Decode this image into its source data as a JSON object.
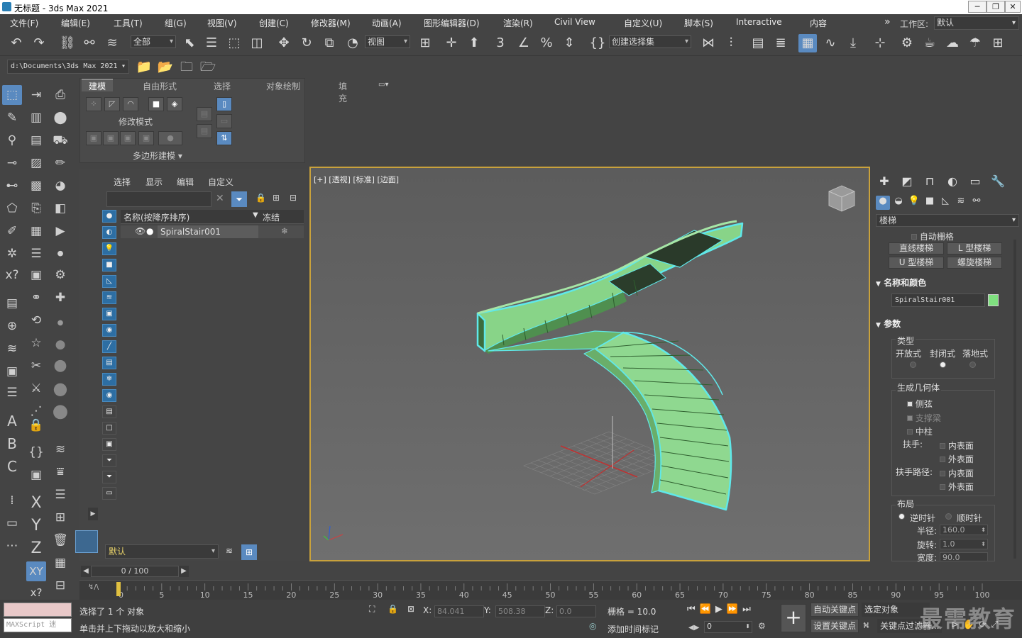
{
  "window": {
    "title": "无标题 - 3ds Max 2021"
  },
  "menu": [
    "文件(F)",
    "编辑(E)",
    "工具(T)",
    "组(G)",
    "视图(V)",
    "创建(C)",
    "修改器(M)",
    "动画(A)",
    "图形编辑器(D)",
    "渲染(R)",
    "Civil View",
    "自定义(U)",
    "脚本(S)",
    "Interactive",
    "内容"
  ],
  "workspace": {
    "label": "工作区:",
    "value": "默认"
  },
  "toolbar": {
    "filter": "全部",
    "refcoord": "视图",
    "selset": "创建选择集"
  },
  "path": "d:\\Documents\\3ds Max 2021",
  "ribbon": {
    "tabs": [
      "建模",
      "自由形式",
      "选择",
      "对象绘制",
      "填充"
    ],
    "mode_label": "修改模式",
    "group_label": "多边形建模"
  },
  "explorer": {
    "menu": [
      "选择",
      "显示",
      "编辑",
      "自定义"
    ],
    "col_name": "名称(按降序排序)",
    "col_freeze": "冻结",
    "row_name": "SpiralStair001",
    "layer": "默认"
  },
  "viewport": {
    "label": "[+] [透视] [标准] [边面]"
  },
  "cmdpanel": {
    "category": "楼梯",
    "autogrid": "自动栅格",
    "buttons": [
      "直线楼梯",
      "L 型楼梯",
      "U 型楼梯",
      "螺旋楼梯"
    ],
    "name_color_title": "名称和颜色",
    "object_name": "SpiralStair001",
    "params_title": "参数",
    "type_label": "类型",
    "types": [
      "开放式",
      "封闭式",
      "落地式"
    ],
    "geom_label": "生成几何体",
    "geom_items": [
      "侧弦",
      "支撑梁",
      "中柱"
    ],
    "rail_label": "扶手:",
    "rail_path_label": "扶手路径:",
    "inner": "内表面",
    "outer": "外表面",
    "layout_label": "布局",
    "ccw": "逆时针",
    "cw": "顺时针",
    "radius_label": "半径:",
    "radius_value": "160.0",
    "revs_label": "旋转:",
    "revs_value": "1.0",
    "width_label": "宽度:",
    "width_value": "90.0",
    "swatch_color": "#7fe07f"
  },
  "timeline": {
    "frame": "0 / 100",
    "ticks": [
      "0",
      "5",
      "10",
      "15",
      "20",
      "25",
      "30",
      "35",
      "40",
      "45",
      "50",
      "55",
      "60",
      "65",
      "70",
      "75",
      "80",
      "85",
      "90",
      "95",
      "100"
    ]
  },
  "status": {
    "selected": "选择了 1 个 对象",
    "hint": "单击并上下拖动以放大和缩小",
    "maxscript": "MAXScript 迷",
    "x_label": "X:",
    "x_value": "84.041",
    "y_label": "Y:",
    "y_value": "508.38",
    "z_label": "Z:",
    "z_value": "0.0",
    "grid": "栅格 = 10.0",
    "add_time_tag": "添加时间标记",
    "auto_key": "自动关键点",
    "set_key": "设置关键点",
    "sel_obj": "选定对象",
    "key_filters": "关键点过滤器...",
    "frame_spin": "0",
    "watermark": "最需教育"
  }
}
